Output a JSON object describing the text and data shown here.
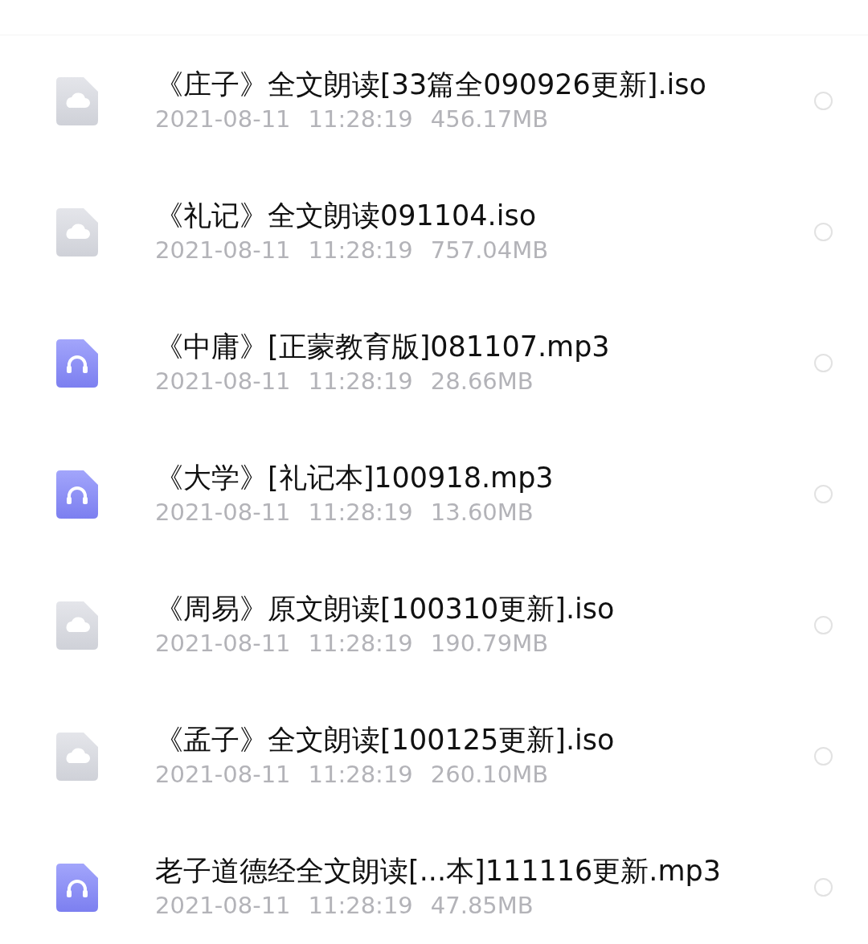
{
  "files": [
    {
      "kind": "disk",
      "name": "《庄子》全文朗读[33篇全090926更新].iso",
      "date": "2021-08-11",
      "time": "11:28:19",
      "size": "456.17MB",
      "selected": false
    },
    {
      "kind": "disk",
      "name": "《礼记》全文朗读091104.iso",
      "date": "2021-08-11",
      "time": "11:28:19",
      "size": "757.04MB",
      "selected": false
    },
    {
      "kind": "audio",
      "name": "《中庸》[正蒙教育版]081107.mp3",
      "date": "2021-08-11",
      "time": "11:28:19",
      "size": "28.66MB",
      "selected": false
    },
    {
      "kind": "audio",
      "name": "《大学》[礼记本]100918.mp3",
      "date": "2021-08-11",
      "time": "11:28:19",
      "size": "13.60MB",
      "selected": false
    },
    {
      "kind": "disk",
      "name": "《周易》原文朗读[100310更新].iso",
      "date": "2021-08-11",
      "time": "11:28:19",
      "size": "190.79MB",
      "selected": false
    },
    {
      "kind": "disk",
      "name": "《孟子》全文朗读[100125更新].iso",
      "date": "2021-08-11",
      "time": "11:28:19",
      "size": "260.10MB",
      "selected": false
    },
    {
      "kind": "audio",
      "name": "老子道德经全文朗读[...本]111116更新.mp3",
      "date": "2021-08-11",
      "time": "11:28:19",
      "size": "47.85MB",
      "selected": false
    }
  ]
}
